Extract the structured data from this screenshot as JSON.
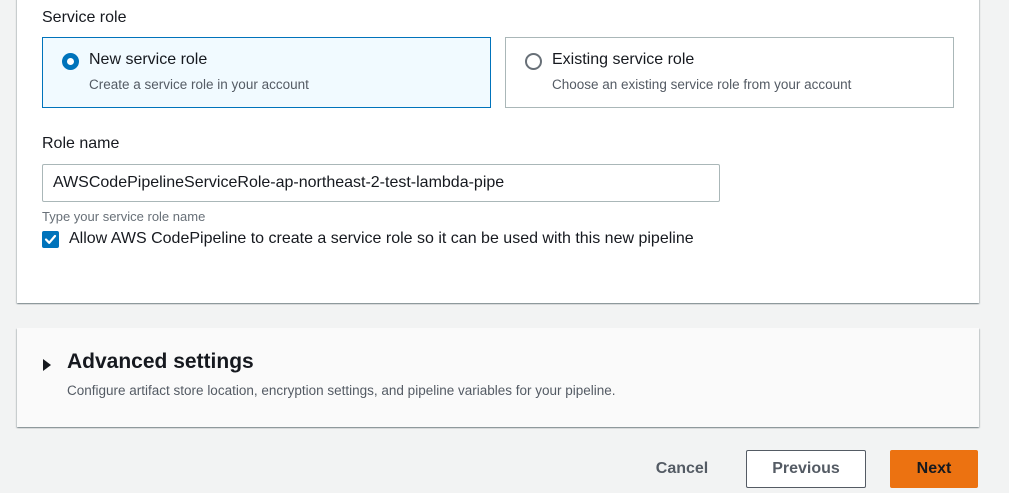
{
  "service_role": {
    "label": "Service role",
    "options": [
      {
        "title": "New service role",
        "description": "Create a service role in your account",
        "selected": true
      },
      {
        "title": "Existing service role",
        "description": "Choose an existing service role from your account",
        "selected": false
      }
    ]
  },
  "role_name": {
    "label": "Role name",
    "value": "AWSCodePipelineServiceRole-ap-northeast-2-test-lambda-pipe",
    "hint": "Type your service role name"
  },
  "allow_checkbox": {
    "checked": true,
    "label": "Allow AWS CodePipeline to create a service role so it can be used with this new pipeline"
  },
  "advanced_settings": {
    "title": "Advanced settings",
    "description": "Configure artifact store location, encryption settings, and pipeline variables for your pipeline.",
    "expanded": false
  },
  "footer": {
    "cancel_label": "Cancel",
    "previous_label": "Previous",
    "next_label": "Next"
  },
  "colors": {
    "accent": "#0073bb",
    "primary_button": "#ec7211",
    "selected_tile_bg": "#f1faff"
  }
}
